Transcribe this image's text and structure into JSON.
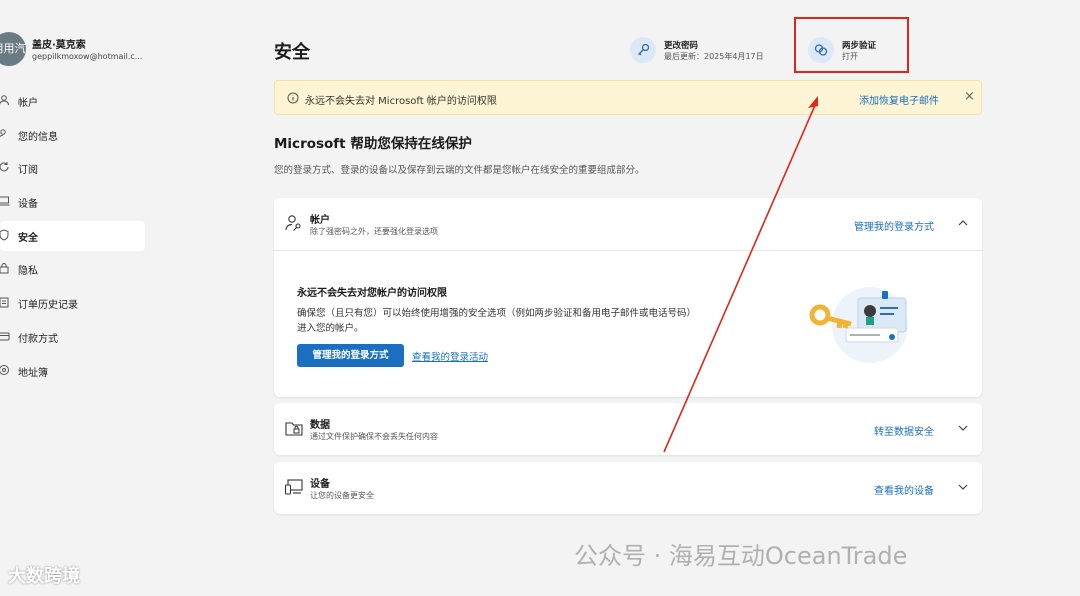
{
  "profile": {
    "avatar_text": "用用汽",
    "name": "盖皮·莫克索",
    "email": "geppilkmoxow@hotmail.c..."
  },
  "sidebar": {
    "items": [
      {
        "label": "帐户",
        "icon": "person-icon",
        "active": false
      },
      {
        "label": "您的信息",
        "icon": "id-icon",
        "active": false
      },
      {
        "label": "订阅",
        "icon": "refresh-icon",
        "active": false
      },
      {
        "label": "设备",
        "icon": "laptop-icon",
        "active": false
      },
      {
        "label": "安全",
        "icon": "shield-icon",
        "active": true
      },
      {
        "label": "隐私",
        "icon": "lock-icon",
        "active": false
      },
      {
        "label": "订单历史记录",
        "icon": "history-icon",
        "active": false
      },
      {
        "label": "付款方式",
        "icon": "card-icon",
        "active": false
      },
      {
        "label": "地址簿",
        "icon": "location-icon",
        "active": false
      }
    ]
  },
  "header": {
    "title": "安全",
    "change_password": {
      "title": "更改密码",
      "subtitle": "最后更新：2025年4月17日",
      "icon": "key-icon"
    },
    "two_step": {
      "title": "两步验证",
      "subtitle": "打开",
      "icon": "chain-icon"
    }
  },
  "banner": {
    "text": "永远不会失去对 Microsoft 帐户的访问权限",
    "link": "添加恢复电子邮件",
    "close": "×",
    "icon": "info-icon"
  },
  "main": {
    "heading": "Microsoft 帮助您保持在线保护",
    "description": "您的登录方式、登录的设备以及保存到云端的文件都是您帐户在线安全的重要组成部分。"
  },
  "cards": [
    {
      "title": "帐户",
      "subtitle": "除了强密码之外，还要强化登录选项",
      "link": "管理我的登录方式",
      "icon": "account-key-icon",
      "expanded": true,
      "content": {
        "title": "永远不会失去对您帐户的访问权限",
        "body": "确保您（且只有您）可以始终使用增强的安全选项（例如两步验证和备用电子邮件或电话号码）进入您的帐户。",
        "button": "管理我的登录方式",
        "link": "查看我的登录活动"
      }
    },
    {
      "title": "数据",
      "subtitle": "通过文件保护确保不会丢失任何内容",
      "link": "转至数据安全",
      "icon": "folder-lock-icon",
      "expanded": false
    },
    {
      "title": "设备",
      "subtitle": "让您的设备更安全",
      "link": "查看我的设备",
      "icon": "devices-icon",
      "expanded": false
    }
  ],
  "watermarks": {
    "left": "大数跨境",
    "right": "公众号 · 海易互动OceanTrade"
  },
  "colors": {
    "accent": "#1a6fc1",
    "banner_bg": "#fdf4d3",
    "highlight": "#e0261c",
    "page_bg": "#f3f3f3"
  }
}
